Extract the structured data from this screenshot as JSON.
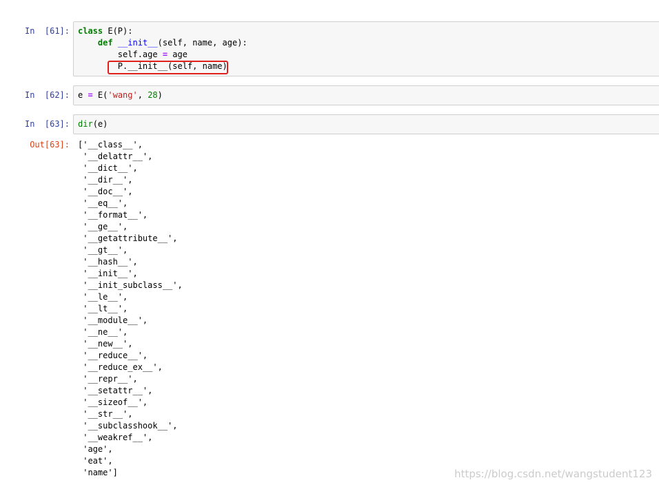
{
  "cells": [
    {
      "prompt": "In  [61]:",
      "lines": [
        {
          "parts": [
            {
              "t": "class",
              "c": "kw"
            },
            {
              "t": " E(P):",
              "c": ""
            }
          ]
        },
        {
          "parts": [
            {
              "t": "    ",
              "c": ""
            },
            {
              "t": "def",
              "c": "kw"
            },
            {
              "t": " ",
              "c": ""
            },
            {
              "t": "__init__",
              "c": "fn"
            },
            {
              "t": "(self, name, age):",
              "c": ""
            }
          ]
        },
        {
          "parts": [
            {
              "t": "        self.age ",
              "c": ""
            },
            {
              "t": "=",
              "c": "op"
            },
            {
              "t": " age",
              "c": ""
            }
          ]
        },
        {
          "parts": [
            {
              "t": "        P.__init__(self, name)",
              "c": ""
            }
          ]
        }
      ]
    },
    {
      "prompt": "In  [62]:",
      "lines": [
        {
          "parts": [
            {
              "t": "e ",
              "c": ""
            },
            {
              "t": "=",
              "c": "op"
            },
            {
              "t": " E(",
              "c": ""
            },
            {
              "t": "'wang'",
              "c": "str"
            },
            {
              "t": ", ",
              "c": ""
            },
            {
              "t": "28",
              "c": "num"
            },
            {
              "t": ")",
              "c": ""
            }
          ]
        }
      ]
    },
    {
      "prompt": "In  [63]:",
      "lines": [
        {
          "parts": [
            {
              "t": "dir",
              "c": "bi"
            },
            {
              "t": "(e)",
              "c": ""
            }
          ]
        }
      ]
    }
  ],
  "output": {
    "prompt": "Out[63]:",
    "lines": [
      "['__class__',",
      " '__delattr__',",
      " '__dict__',",
      " '__dir__',",
      " '__doc__',",
      " '__eq__',",
      " '__format__',",
      " '__ge__',",
      " '__getattribute__',",
      " '__gt__',",
      " '__hash__',",
      " '__init__',",
      " '__init_subclass__',",
      " '__le__',",
      " '__lt__',",
      " '__module__',",
      " '__ne__',",
      " '__new__',",
      " '__reduce__',",
      " '__reduce_ex__',",
      " '__repr__',",
      " '__setattr__',",
      " '__sizeof__',",
      " '__str__',",
      " '__subclasshook__',",
      " '__weakref__',",
      " 'age',",
      " 'eat',",
      " 'name']"
    ]
  },
  "watermark": "https://blog.csdn.net/wangstudent123",
  "colors": {
    "highlight_border": "#e0201b",
    "prompt_in": "#303f9f",
    "prompt_out": "#d84315"
  }
}
